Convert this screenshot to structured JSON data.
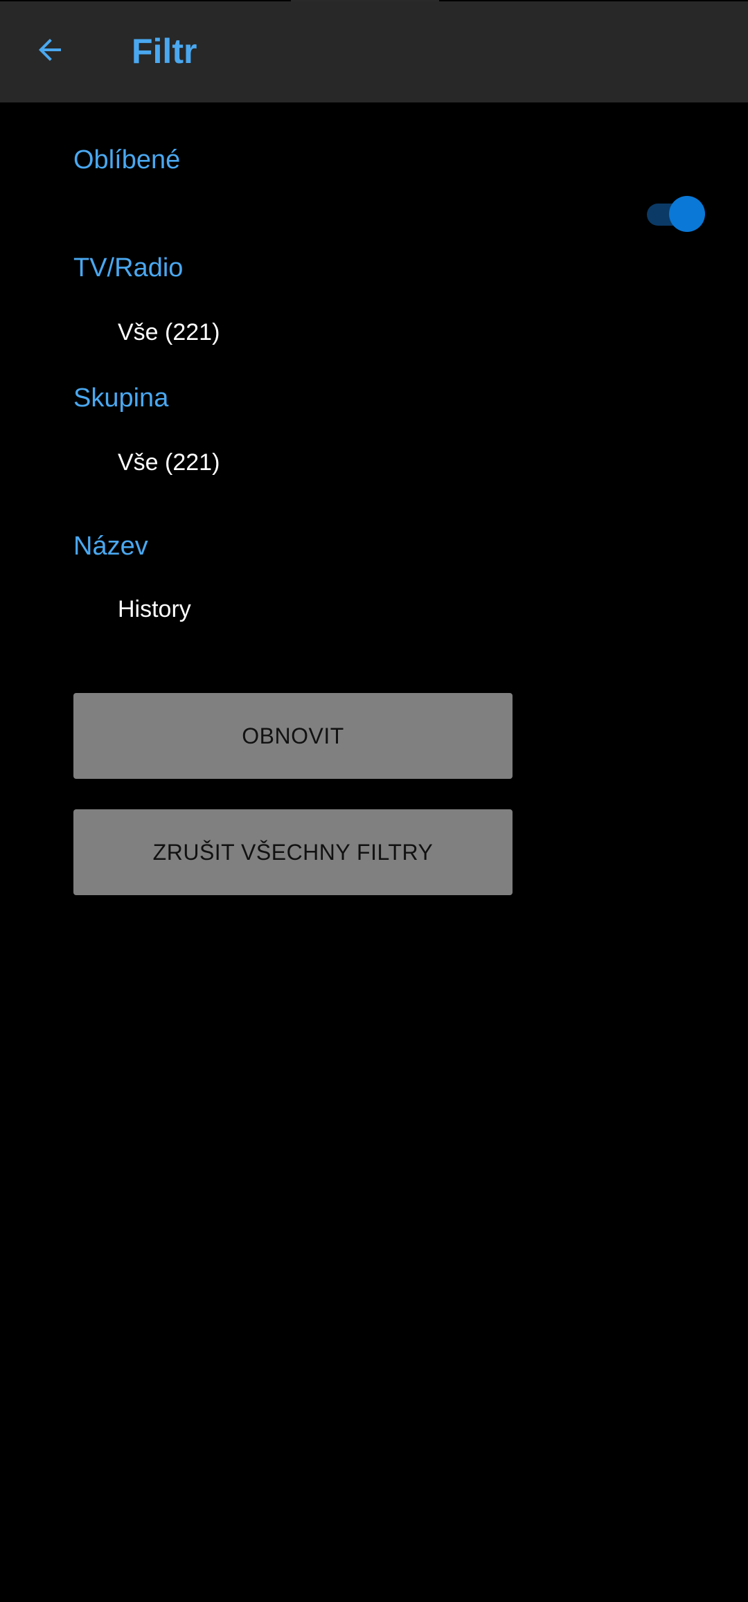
{
  "colors": {
    "accent": "#4aa8f0",
    "appbar_bg": "#282828",
    "background": "#000000",
    "toggle_thumb": "#0a78d6",
    "toggle_track": "#0b3a66",
    "button_bg": "#808080"
  },
  "header": {
    "back_icon": "arrow-left-icon",
    "title": "Filtr"
  },
  "favorites": {
    "label": "Oblíbené",
    "toggle_on": true
  },
  "tv_radio": {
    "label": "TV/Radio",
    "value": "Vše (221)"
  },
  "group": {
    "label": "Skupina",
    "value": "Vše (221)"
  },
  "name": {
    "label": "Název",
    "value": "History"
  },
  "actions": {
    "refresh_label": "OBNOVIT",
    "clear_label": "ZRUŠIT VŠECHNY FILTRY"
  }
}
